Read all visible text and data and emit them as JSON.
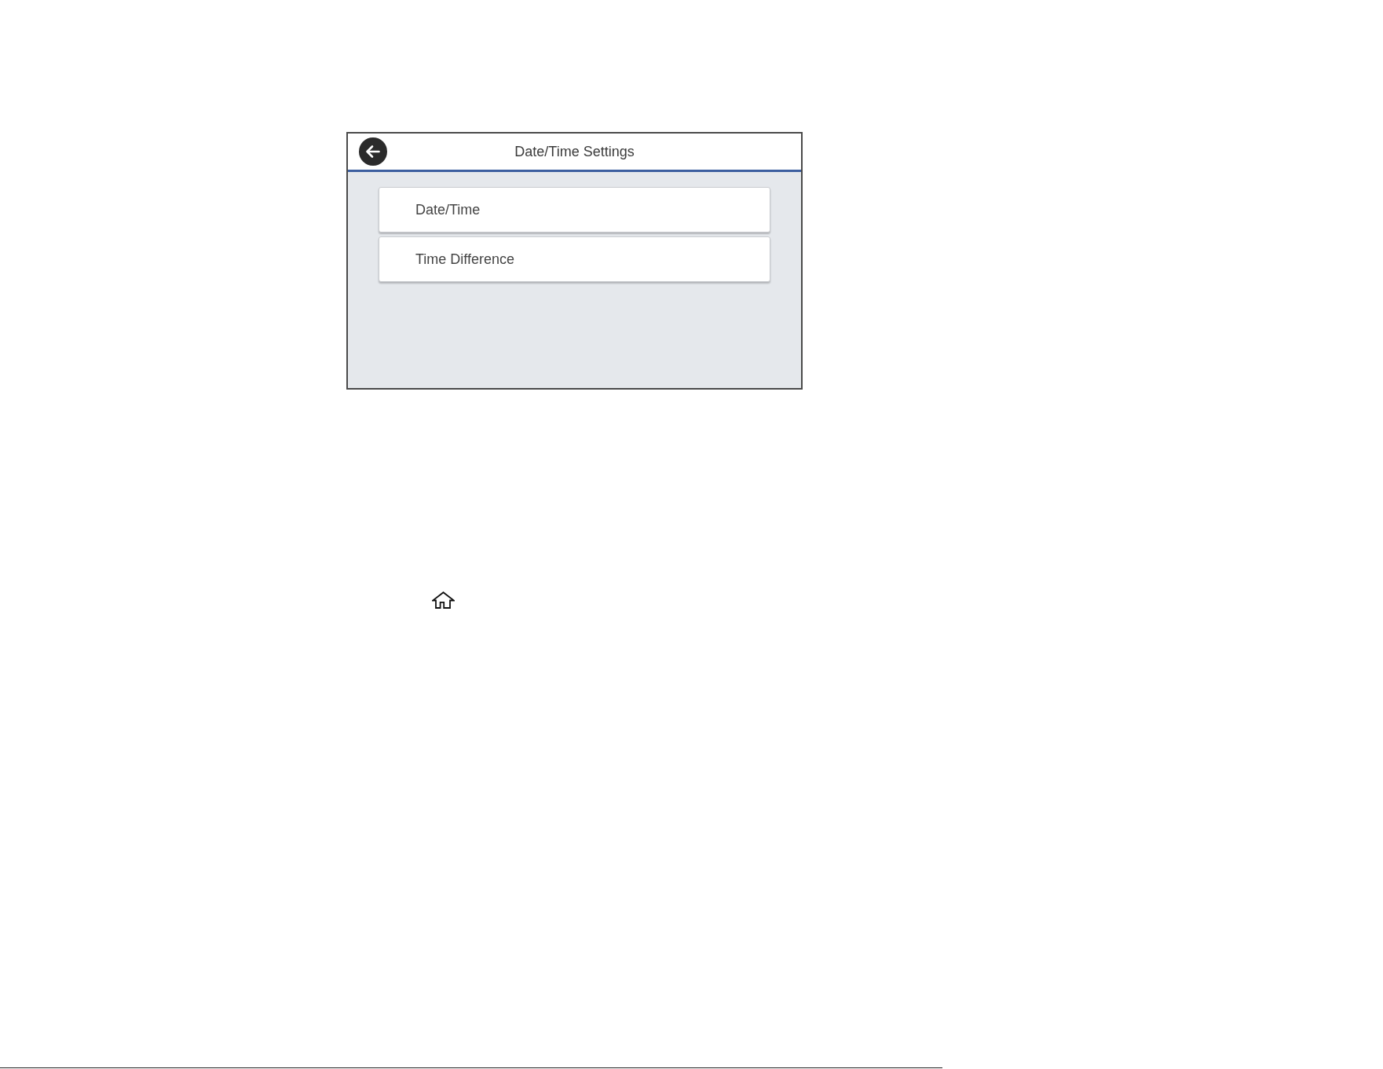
{
  "screen": {
    "title": "Date/Time Settings",
    "menu_items": [
      {
        "label": "Date/Time"
      },
      {
        "label": "Time Difference"
      }
    ]
  }
}
